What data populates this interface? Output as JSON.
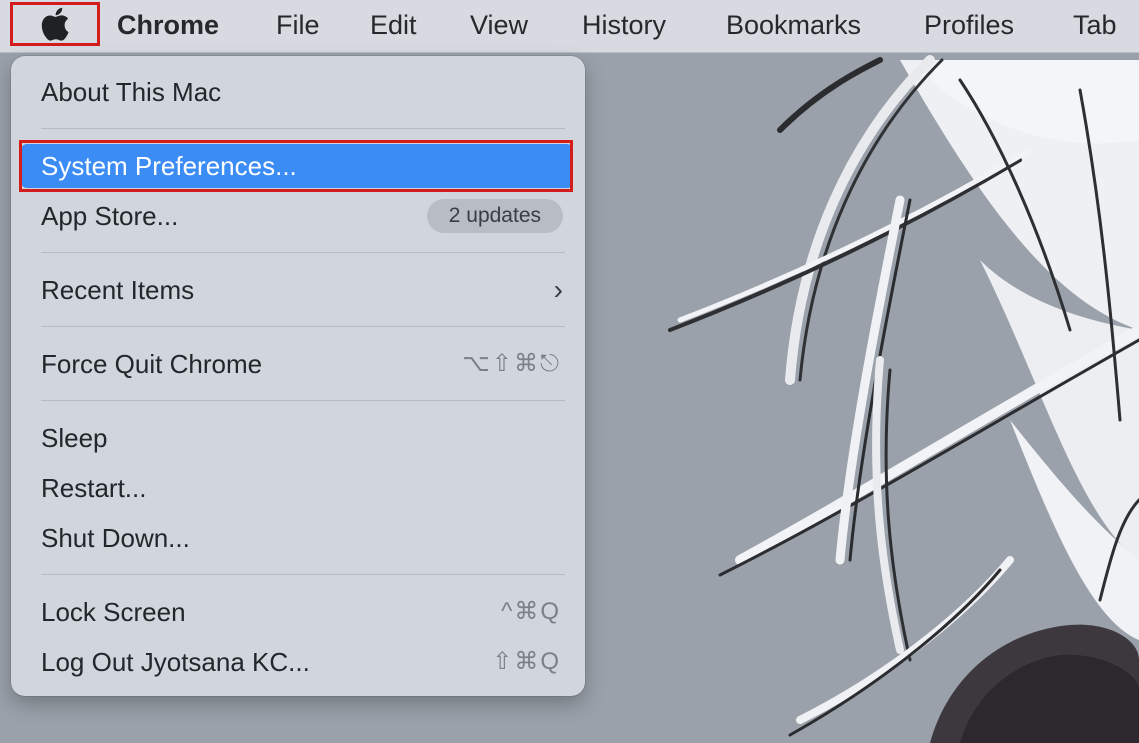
{
  "menubar": {
    "apple_icon": "apple-icon",
    "items": [
      {
        "label": "Chrome"
      },
      {
        "label": "File"
      },
      {
        "label": "Edit"
      },
      {
        "label": "View"
      },
      {
        "label": "History"
      },
      {
        "label": "Bookmarks"
      },
      {
        "label": "Profiles"
      },
      {
        "label": "Tab"
      }
    ]
  },
  "apple_menu": {
    "about": "About This Mac",
    "system_prefs": "System Preferences...",
    "app_store": "App Store...",
    "app_store_badge": "2 updates",
    "recent_items": "Recent Items",
    "recent_items_chevron": "›",
    "force_quit": "Force Quit Chrome",
    "force_quit_shortcut": "⌥⇧⌘⎋",
    "sleep": "Sleep",
    "restart": "Restart...",
    "shut_down": "Shut Down...",
    "lock_screen": "Lock Screen",
    "lock_screen_shortcut": "^⌘Q",
    "log_out": "Log Out Jyotsana KC...",
    "log_out_shortcut": "⇧⌘Q"
  },
  "colors": {
    "highlight": "#3b8cf5",
    "annotation_box": "#d41c1c",
    "menu_bg": "#d1d5dc"
  }
}
